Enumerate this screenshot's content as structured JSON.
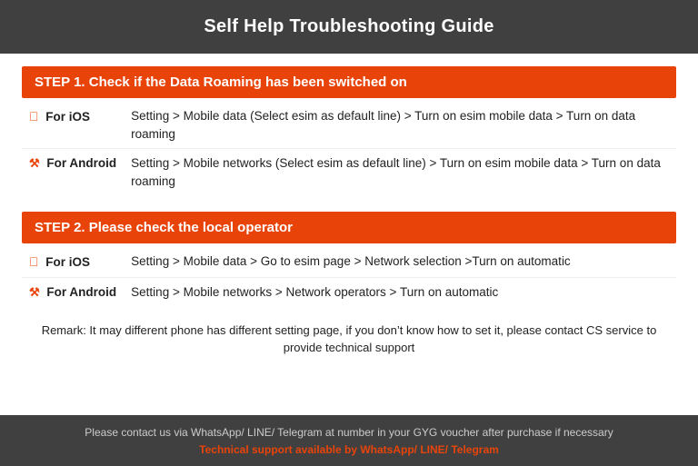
{
  "header": {
    "title": "Self Help Troubleshooting Guide"
  },
  "step1": {
    "heading": "STEP 1.  Check if the Data Roaming has been switched on",
    "ios_label": "For iOS",
    "ios_instruction": "Setting > Mobile data (Select esim as default line) > Turn on esim mobile data > Turn on data roaming",
    "android_label": "For Android",
    "android_instruction": "Setting > Mobile networks (Select esim as default line) > Turn on esim mobile data > Turn on data roaming"
  },
  "step2": {
    "heading": "STEP 2.  Please check the local operator",
    "ios_label": "For iOS",
    "ios_instruction": "Setting > Mobile data > Go to esim page > Network selection >Turn on automatic",
    "android_label": "For Android",
    "android_instruction": "Setting > Mobile networks > Network operators > Turn on automatic"
  },
  "remark": {
    "text": "Remark: It may different phone has different setting page, if you don’t know how to set it,  please contact CS service to provide technical support"
  },
  "footer": {
    "line1": "Please contact us via WhatsApp/ LINE/ Telegram at number in your GYG voucher after purchase if necessary",
    "line2": "Technical support available by WhatsApp/ LINE/ Telegram"
  }
}
